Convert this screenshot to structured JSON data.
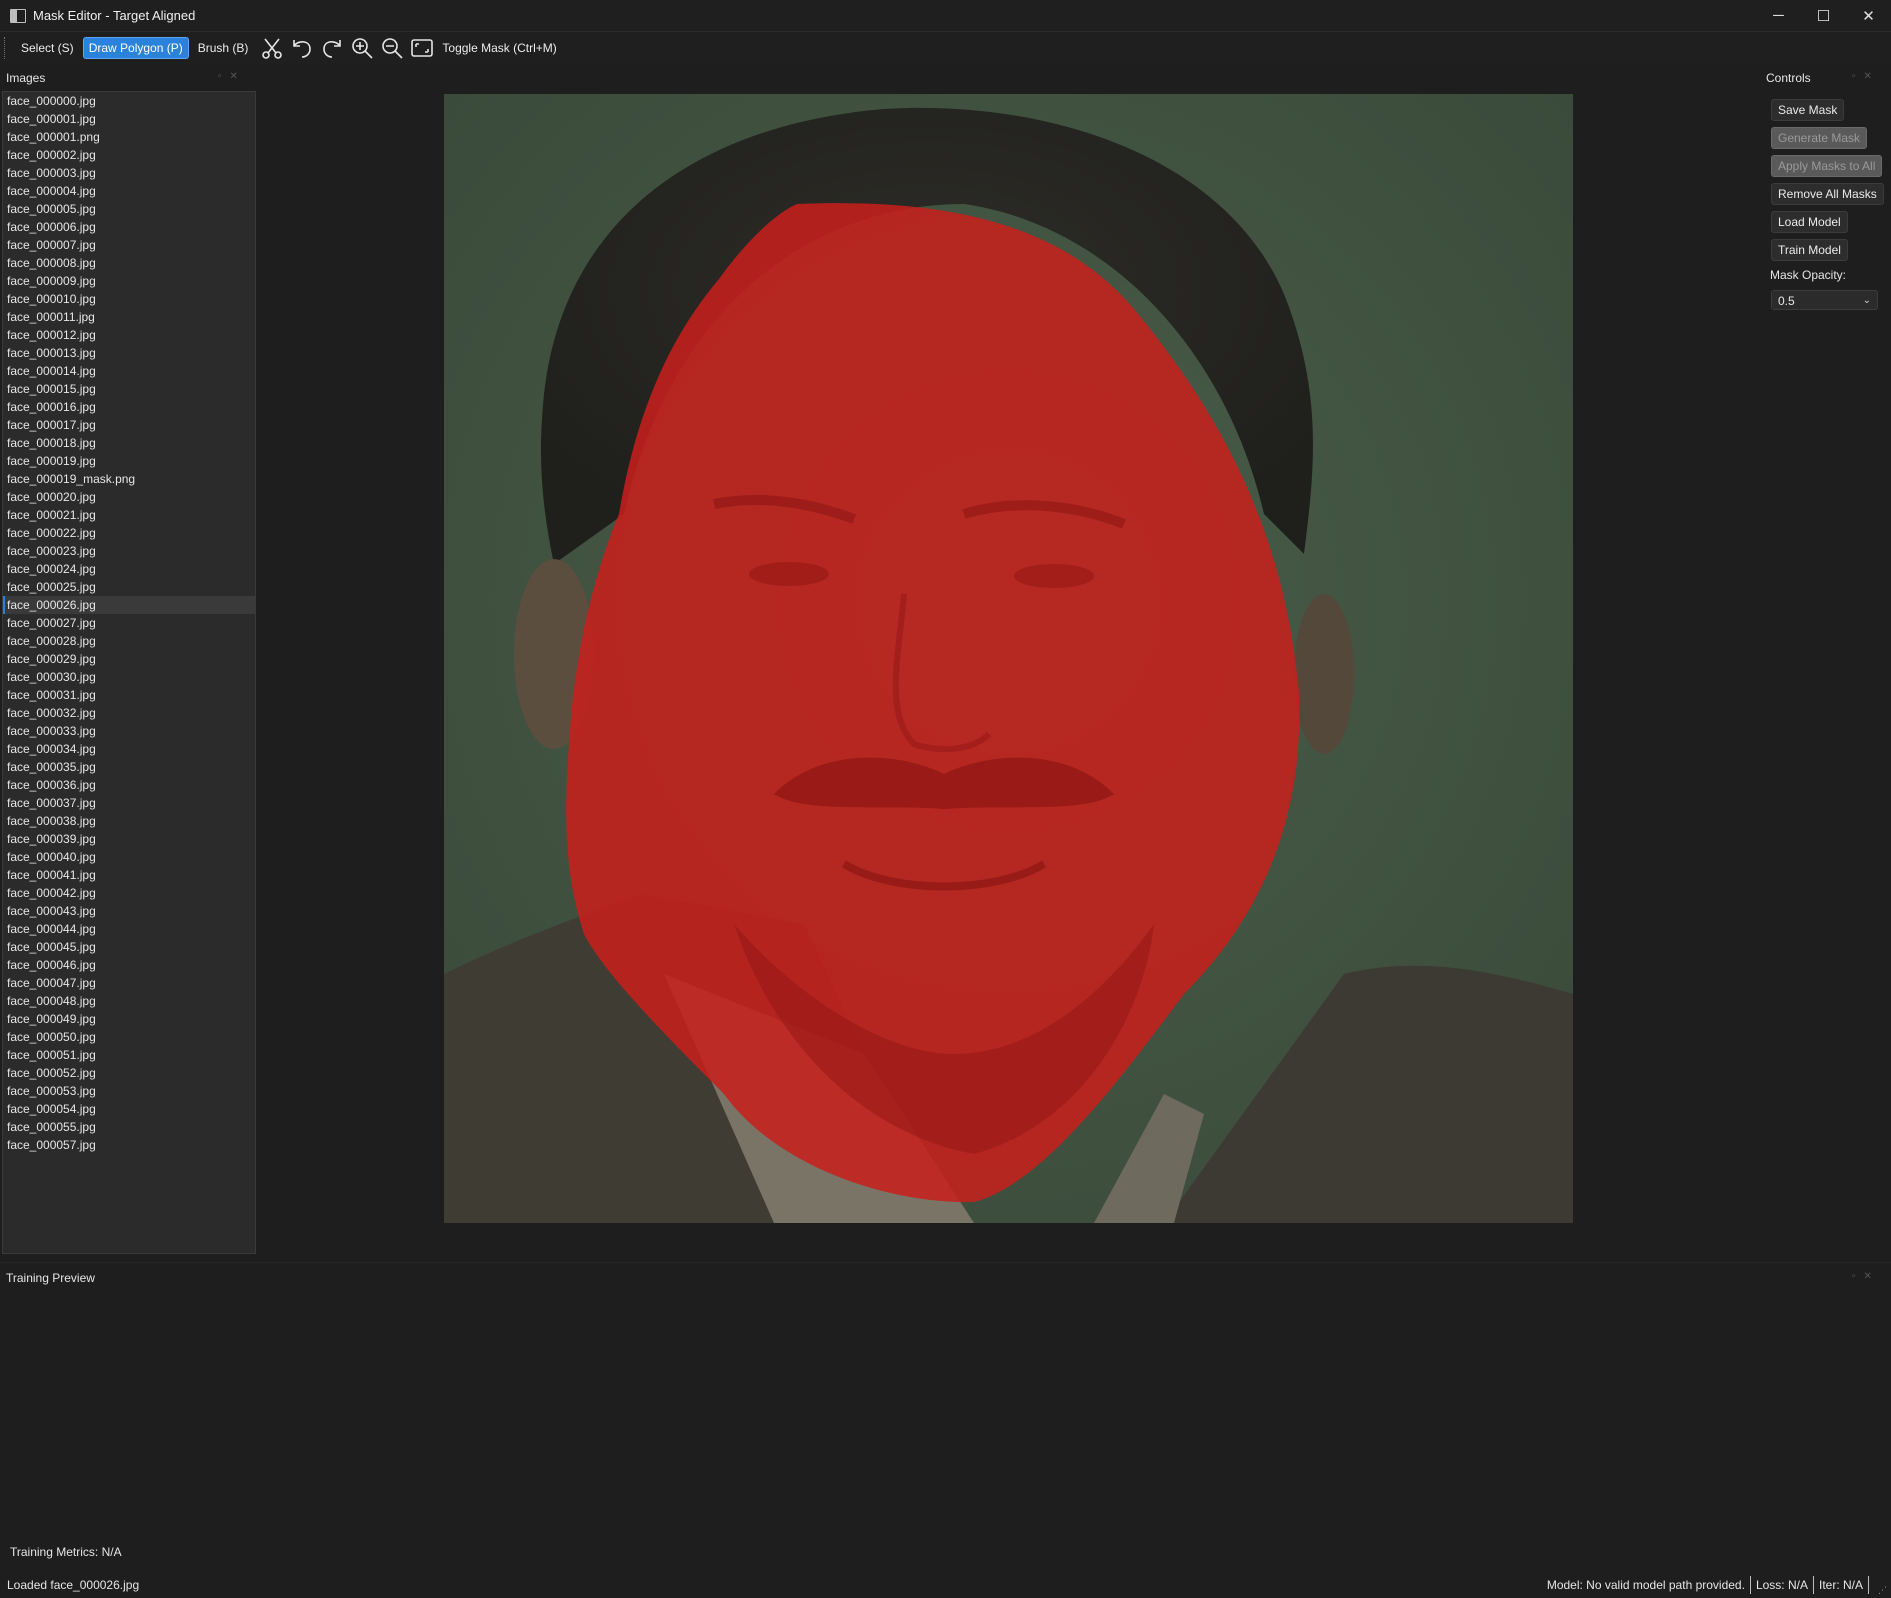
{
  "window": {
    "title": "Mask Editor - Target Aligned",
    "minimize": "─",
    "maximize": "☐",
    "close": "✕"
  },
  "toolbar": {
    "select": "Select (S)",
    "draw_polygon": "Draw Polygon (P)",
    "brush": "Brush (B)",
    "toggle_mask": "Toggle Mask (Ctrl+M)",
    "active_tool": "draw_polygon",
    "icons": [
      "scissors-icon",
      "undo-icon",
      "redo-icon",
      "zoom-in-icon",
      "zoom-out-icon",
      "fit-view-icon"
    ]
  },
  "images_panel": {
    "title": "Images",
    "selected": "face_000026.jpg",
    "files": [
      "face_000000.jpg",
      "face_000001.jpg",
      "face_000001.png",
      "face_000002.jpg",
      "face_000003.jpg",
      "face_000004.jpg",
      "face_000005.jpg",
      "face_000006.jpg",
      "face_000007.jpg",
      "face_000008.jpg",
      "face_000009.jpg",
      "face_000010.jpg",
      "face_000011.jpg",
      "face_000012.jpg",
      "face_000013.jpg",
      "face_000014.jpg",
      "face_000015.jpg",
      "face_000016.jpg",
      "face_000017.jpg",
      "face_000018.jpg",
      "face_000019.jpg",
      "face_000019_mask.png",
      "face_000020.jpg",
      "face_000021.jpg",
      "face_000022.jpg",
      "face_000023.jpg",
      "face_000024.jpg",
      "face_000025.jpg",
      "face_000026.jpg",
      "face_000027.jpg",
      "face_000028.jpg",
      "face_000029.jpg",
      "face_000030.jpg",
      "face_000031.jpg",
      "face_000032.jpg",
      "face_000033.jpg",
      "face_000034.jpg",
      "face_000035.jpg",
      "face_000036.jpg",
      "face_000037.jpg",
      "face_000038.jpg",
      "face_000039.jpg",
      "face_000040.jpg",
      "face_000041.jpg",
      "face_000042.jpg",
      "face_000043.jpg",
      "face_000044.jpg",
      "face_000045.jpg",
      "face_000046.jpg",
      "face_000047.jpg",
      "face_000048.jpg",
      "face_000049.jpg",
      "face_000050.jpg",
      "face_000051.jpg",
      "face_000052.jpg",
      "face_000053.jpg",
      "face_000054.jpg",
      "face_000055.jpg",
      "face_000057.jpg"
    ]
  },
  "canvas": {
    "mask_color": "#c8201c",
    "background_color": "#445544"
  },
  "controls_panel": {
    "title": "Controls",
    "save_mask": "Save Mask",
    "generate_mask": "Generate Mask",
    "apply_masks_to_all": "Apply Masks to All",
    "remove_all_masks": "Remove All Masks",
    "load_model": "Load Model",
    "train_model": "Train Model",
    "mask_opacity_label": "Mask Opacity:",
    "mask_opacity_value": "0.5"
  },
  "training_panel": {
    "title": "Training Preview",
    "metrics": "Training Metrics: N/A"
  },
  "status_bar": {
    "message": "Loaded face_000026.jpg",
    "model": "Model: No valid model path provided.",
    "loss": "Loss: N/A",
    "iter": "Iter: N/A"
  }
}
